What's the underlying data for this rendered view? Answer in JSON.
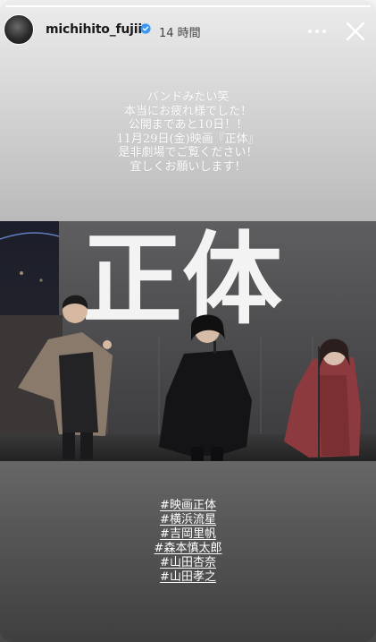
{
  "story": {
    "progress": 1.0,
    "username": "michihito_fujii",
    "verified": true,
    "time_ago": "14 時間",
    "icons": {
      "more": "more-options-icon",
      "close": "close-icon",
      "verified": "verified-badge-icon"
    }
  },
  "caption": {
    "lines": [
      "バンドみたい笑",
      "本当にお疲れ様でした！",
      "公開まであと10日！！",
      "11月29日(金)映画『正体』",
      "是非劇場でご覧ください！",
      "宜しくお願いします！"
    ]
  },
  "photo": {
    "sign_text": "正体"
  },
  "hashtags": [
    "#映画正体",
    "#横浜流星",
    "#吉岡里帆",
    "#森本慎太郎",
    "#山田杏奈",
    "#山田孝之"
  ],
  "colors": {
    "text_dark": "#1a1a1a",
    "verified_blue": "#3897f0",
    "overlay_text": "#ffffff"
  }
}
